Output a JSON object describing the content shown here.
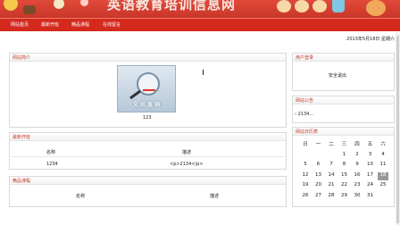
{
  "header": {
    "site_title": "英语教育培训信息网",
    "banner_color": "#d42a1e"
  },
  "nav": {
    "items": [
      "网站首页",
      "最新开班",
      "精品课程",
      "在线留言"
    ]
  },
  "date_text": "2013年5月18日 星期六",
  "main": {
    "intro_panel": {
      "title": "网站简介",
      "image_caption": "文 出 查 询",
      "image_label": "123"
    },
    "latest_panel": {
      "title": "最新开班",
      "headers": [
        "名称",
        "描述"
      ],
      "rows": [
        [
          "1234",
          "<p>2134</p>"
        ]
      ]
    },
    "course_panel": {
      "title": "精品课程",
      "headers": [
        "名称",
        "描述"
      ]
    }
  },
  "sidebar": {
    "login_panel": {
      "title": "用户登录",
      "logout_label": "安全退出"
    },
    "notice_panel": {
      "title": "网站公告",
      "items": [
        "2134..."
      ]
    },
    "calendar_panel": {
      "title": "网站日历表",
      "weekdays": [
        "日",
        "一",
        "二",
        "三",
        "四",
        "五",
        "六"
      ],
      "weeks": [
        [
          "",
          "",
          "",
          "1",
          "2",
          "3",
          "4"
        ],
        [
          "5",
          "6",
          "7",
          "8",
          "9",
          "10",
          "11"
        ],
        [
          "12",
          "13",
          "14",
          "15",
          "16",
          "17",
          "18"
        ],
        [
          "19",
          "20",
          "21",
          "22",
          "23",
          "24",
          "25"
        ],
        [
          "26",
          "27",
          "28",
          "29",
          "30",
          "31",
          ""
        ]
      ],
      "today": "18"
    }
  }
}
